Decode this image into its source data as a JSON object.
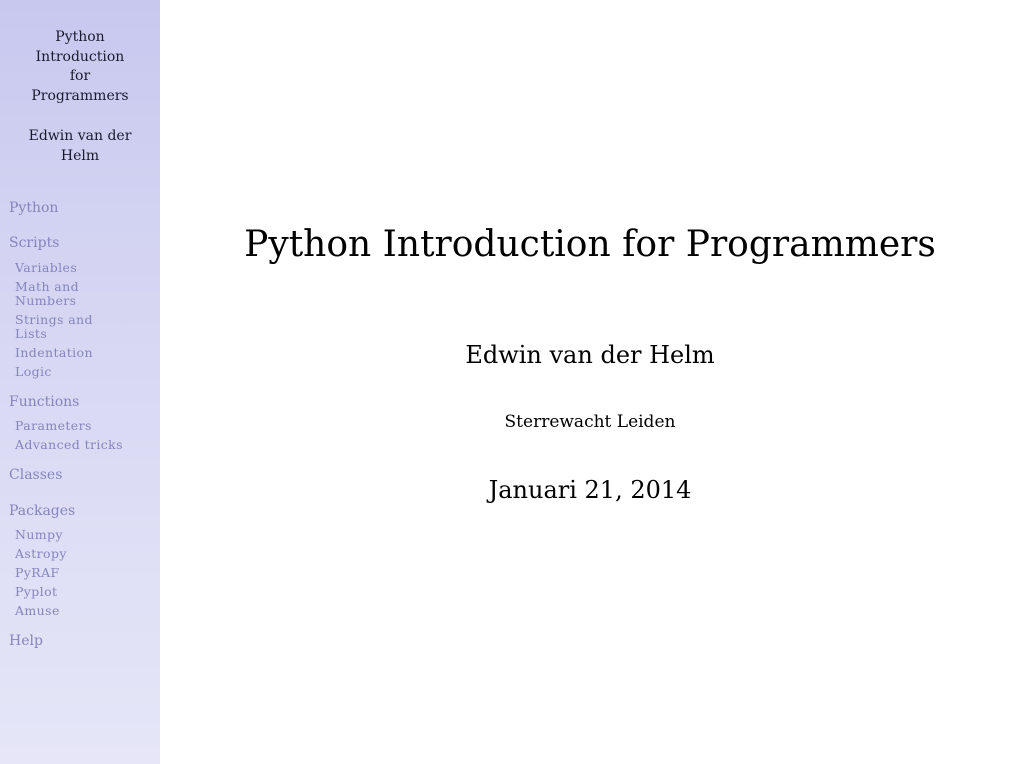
{
  "sidebar": {
    "title_lines": [
      "Python",
      "Introduction",
      "for",
      "Programmers"
    ],
    "author_lines": [
      "Edwin van der",
      "Helm"
    ],
    "nav": {
      "python": "Python",
      "scripts": "Scripts",
      "scripts_items": {
        "variables": [
          "Variables"
        ],
        "math": [
          "Math and",
          "Numbers"
        ],
        "strings": [
          "Strings and",
          "Lists"
        ],
        "indentation": [
          "Indentation"
        ],
        "logic": [
          "Logic"
        ]
      },
      "functions": "Functions",
      "functions_items": {
        "parameters": [
          "Parameters"
        ],
        "advanced": [
          "Advanced tricks"
        ]
      },
      "classes": "Classes",
      "packages": "Packages",
      "packages_items": {
        "numpy": [
          "Numpy"
        ],
        "astropy": [
          "Astropy"
        ],
        "pyraf": [
          "PyRAF"
        ],
        "pyplot": [
          "Pyplot"
        ],
        "amuse": [
          "Amuse"
        ]
      },
      "help": "Help"
    }
  },
  "slide": {
    "title": "Python Introduction for Programmers",
    "author": "Edwin van der Helm",
    "institute": "Sterrewacht Leiden",
    "date": "Januari 21, 2014"
  },
  "colors": {
    "sidebar_top": "#c8c8ef",
    "sidebar_bottom": "#e6e6f8",
    "nav_text": "#8585bd"
  }
}
